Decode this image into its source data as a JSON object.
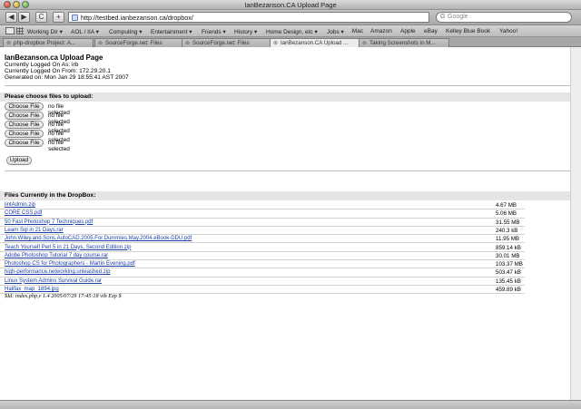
{
  "window": {
    "title": "IanBezanson.CA Upload Page"
  },
  "toolbar": {
    "back_glyph": "◀",
    "forward_glyph": "▶",
    "reload_glyph": "C",
    "add_glyph": "+",
    "url": "http://testbed.ianbezanson.ca/dropbox/",
    "search_placeholder": "Google",
    "search_glyph": "G"
  },
  "bookmarks": [
    {
      "label": "Working Dir ▾"
    },
    {
      "label": "AOL / IIA ▾"
    },
    {
      "label": "Computing ▾"
    },
    {
      "label": "Entertainment ▾"
    },
    {
      "label": "Friends ▾"
    },
    {
      "label": "History ▾"
    },
    {
      "label": "Home Design, etc ▾"
    },
    {
      "label": "Jobs ▾"
    },
    {
      "label": ".Mac"
    },
    {
      "label": "Amazon"
    },
    {
      "label": "Apple"
    },
    {
      "label": "eBay"
    },
    {
      "label": "Kelley Blue Book"
    },
    {
      "label": "Yahoo!"
    }
  ],
  "tabs": [
    {
      "label": "php-dropbox Project: A...",
      "active": false
    },
    {
      "label": "SourceForge.net: Files",
      "active": false
    },
    {
      "label": "SourceForge.net: Files",
      "active": false
    },
    {
      "label": "IanBezanson.CA Upload ...",
      "active": true
    },
    {
      "label": "Taking Screenshots in M...",
      "active": false
    }
  ],
  "page": {
    "title": "IanBezanson.ca Upload Page",
    "logged_on_as": "Currently Logged On As: irb",
    "logged_on_from": "Currently Logged On From: 172.29.20.1",
    "generated_on": "Generated on: Mon Jan 29 18:55:41 AST 2007",
    "upload_heading": "Please choose files to upload:",
    "choose_label": "Choose File",
    "no_file_label": "no file selected",
    "upload_button": "Upload",
    "files_heading": "Files Currently in the DropBox:",
    "files": [
      {
        "name": "lintAdmin.zip",
        "size": "4.67 MB"
      },
      {
        "name": "CORE CSS.pdf",
        "size": "5.06 MB"
      },
      {
        "name": "50 Fast Photoshop 7 Techniques.pdf",
        "size": "31.55 MB"
      },
      {
        "name": "Learn Sql in 21 Days.rar",
        "size": "240.3 kB"
      },
      {
        "name": "John.Wiley.and.Sons.AutoCAD.2005.For.Dummies.May.2004.eBook-DDU.pdf",
        "size": "11.95 MB"
      },
      {
        "name": "Teach Yourself Perl 5 in 21 Days, Second Edition.zip",
        "size": "859.14 kB"
      },
      {
        "name": "Adobe Photoshop Tutorial 7 day course.rar",
        "size": "30.01 MB"
      },
      {
        "name": "Photoshop CS for Photographers - Martin Evening.pdf",
        "size": "103.37 MB"
      },
      {
        "name": "high-performance.networking.unleashed.zip",
        "size": "503.47 kB"
      },
      {
        "name": "Linux System Admins Survival Guide.rar",
        "size": "135.45 kB"
      },
      {
        "name": "Halifax_map_1894.jpg",
        "size": "459.89 kB"
      }
    ],
    "svn_id": "$Id: index.php,v 1.4 2005/07/29 17:45:18 vib Exp $"
  }
}
